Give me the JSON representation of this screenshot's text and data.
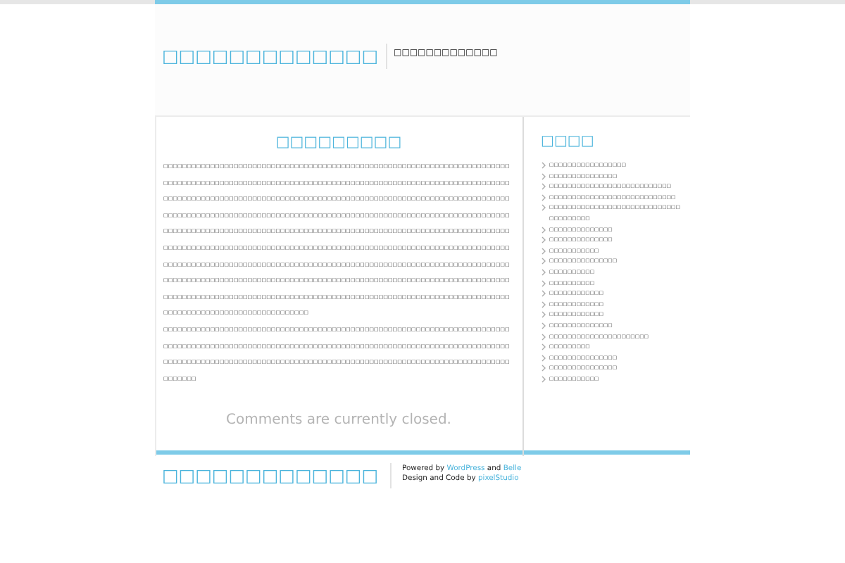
{
  "header": {
    "site_title": "□□□□□□□□□□□□□",
    "tagline": "□□□□□□□□□□□□□"
  },
  "post": {
    "title": "□□□□□□□□□",
    "paragraphs": [
      "□□□□□□□□□□□□□□□□□□□□□□□□□□□□□□□□□□□□□□□□□□□□□□□□□□□□□□□□□□□□□□□□□□□□□□□□□□□□□□□□□□□□□□□□□□□□□□□□□□□□□□□□□□□□□□□□□□□□□□□□□□□□□□□□□□□□□□□□□□□□□□□□□□□□□□□□□□□□□□□□□□□□□□□□□□□□□□□□□□□□□□□□□□□□□□□□□□□□□□□□□□□□□□□□□□□□□□□□□□□□□□□□□□□□□□□□□□□□□□□□□□□□□□□□□□□□□□□□□□□□□□□□□□□□□□□□□□□□□□□□□□□□□□□□□□□□□□□□□□□□□□□□□□□□□□□□□□□□□□□□□□□□□□□□□□□□□□□□□□□□□□□□□□□□□□□□□□□□□□□□□□□□□□□□□□□□□□□□□□□□□□□□□□□□□□□□□□□□□□□□□□□□□□□□□□□□□□□□□□□□□□□□□□□□□□□□□□□□□□□□□□□□□□□□□□□□□□□□□□□□□□□□□□□□□□□□□□□□□□□□□□□□□□□□□□□□□□□□□□□□□□□□□□□□□□□□□□□□□□□□□□□□□□□□□□□□□□□□□□□□□□□□□□□□□□□□□□□□□□□□□□□□□□□□□□□□□□□□□□□□□□□□□□□□□□□□□□□□□□□□□□□□□□□□□□□□□□□□□□□□□□□□□□□□□□□□□□□□□□□□□□□□□□□□□□□□□□□□□□□□□□□□□□□□□□□□□□□□□□□□□□□□□□□□□□□□□□□□□",
      "□□□□□□□□□□□□□□□□□□□□□□□□□□□□□□□□□□□□□□□□□□□□□□□□□□□□□□□□□□□□□□□□□□□□□□□□□□□□□□□□□□□□□□□□□□□□□□□□□□□□□□□□□□□□□□□□□□□□□□□□□□□□□□□□□□□□□□□□□□□□□□□□□□□□□□□□□□□□□□□□□□□□□□□□□□□□□□□□□□□□□□□□□□□□□□□□□□□□□□□□□□□□□□□□□□□□□□□□□□□□□□□□□□□□□"
    ],
    "comments_note": "Comments are currently closed."
  },
  "sidebar": {
    "title": "□□□□",
    "items": [
      "□□□□□□□□□□□□□□□□□",
      "□□□□□□□□□□□□□□□",
      "□□□□□□□□□□□□□□□□□□□□□□□□□□□",
      "□□□□□□□□□□□□□□□□□□□□□□□□□□□□",
      "□□□□□□□□□□□□□□□□□□□□□□□□□□□□□□□□□□□□□□",
      "□□□□□□□□□□□□□□",
      "□□□□□□□□□□□□□□",
      "□□□□□□□□□□□",
      "□□□□□□□□□□□□□□□",
      "□□□□□□□□□□",
      "□□□□□□□□□□",
      "□□□□□□□□□□□□",
      "□□□□□□□□□□□□",
      "□□□□□□□□□□□□",
      "□□□□□□□□□□□□□□",
      "□□□□□□□□□□□□□□□□□□□□□□",
      "□□□□□□□□□",
      "□□□□□□□□□□□□□□□",
      "□□□□□□□□□□□□□□□",
      "□□□□□□□□□□□"
    ]
  },
  "footer": {
    "site_title": "□□□□□□□□□□□□□",
    "credits": [
      [
        {
          "text": "Powered by ",
          "link": false
        },
        {
          "text": "WordPress",
          "link": true
        },
        {
          "text": " and ",
          "link": false
        },
        {
          "text": "Belle",
          "link": true
        }
      ],
      [
        {
          "text": "Design and Code by ",
          "link": false
        },
        {
          "text": "pixelStudio",
          "link": true
        }
      ]
    ]
  }
}
